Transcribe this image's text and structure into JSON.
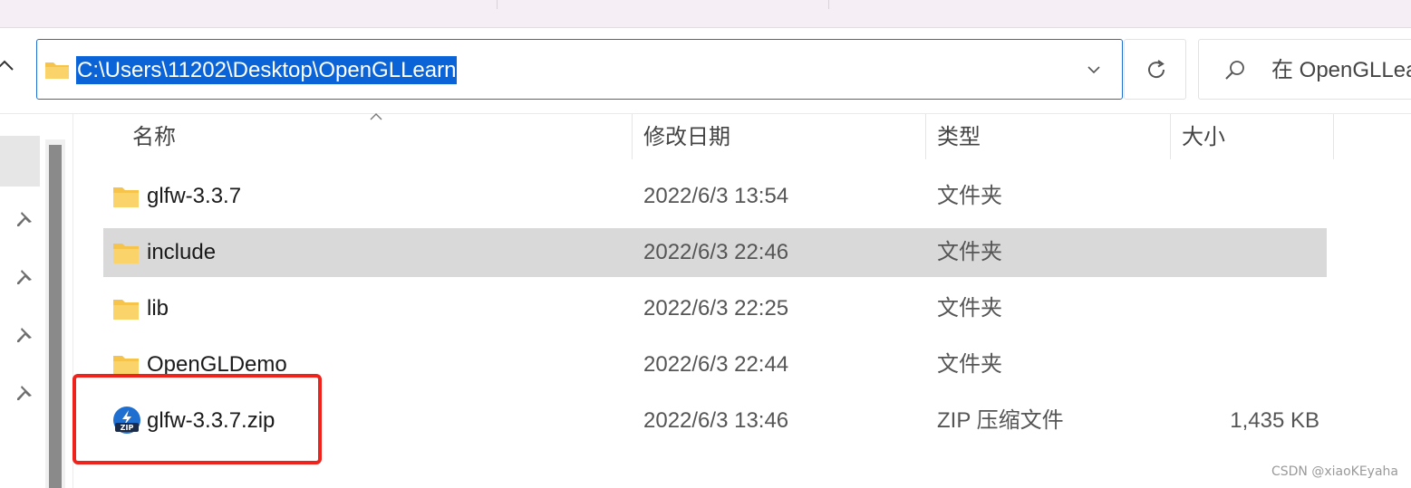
{
  "address_bar": {
    "path": "C:\\Users\\11202\\Desktop\\OpenGLLearn"
  },
  "search": {
    "placeholder": "在 OpenGLLearn 中搜索"
  },
  "columns": {
    "name": "名称",
    "date_modified": "修改日期",
    "type": "类型",
    "size": "大小"
  },
  "files": [
    {
      "name": "glfw-3.3.7",
      "date_modified": "2022/6/3 13:54",
      "type": "文件夹",
      "size": "",
      "icon": "folder-icon"
    },
    {
      "name": "include",
      "date_modified": "2022/6/3 22:46",
      "type": "文件夹",
      "size": "",
      "icon": "folder-icon",
      "selected": true
    },
    {
      "name": "lib",
      "date_modified": "2022/6/3 22:25",
      "type": "文件夹",
      "size": "",
      "icon": "folder-icon"
    },
    {
      "name": "OpenGLDemo",
      "date_modified": "2022/6/3 22:44",
      "type": "文件夹",
      "size": "",
      "icon": "folder-icon"
    },
    {
      "name": "glfw-3.3.7.zip",
      "date_modified": "2022/6/3 13:46",
      "type": "ZIP 压缩文件",
      "size": "1,435 KB",
      "icon": "zip-file-icon",
      "highlighted": true
    }
  ],
  "watermark": "CSDN @xiaoKEyaha",
  "colors": {
    "accent": "#1f6fd1",
    "selection_text_bg": "#0a64d8",
    "row_selected": "#d9d9d9",
    "highlight_box": "#f0221c",
    "folder": "#f6c44a"
  }
}
